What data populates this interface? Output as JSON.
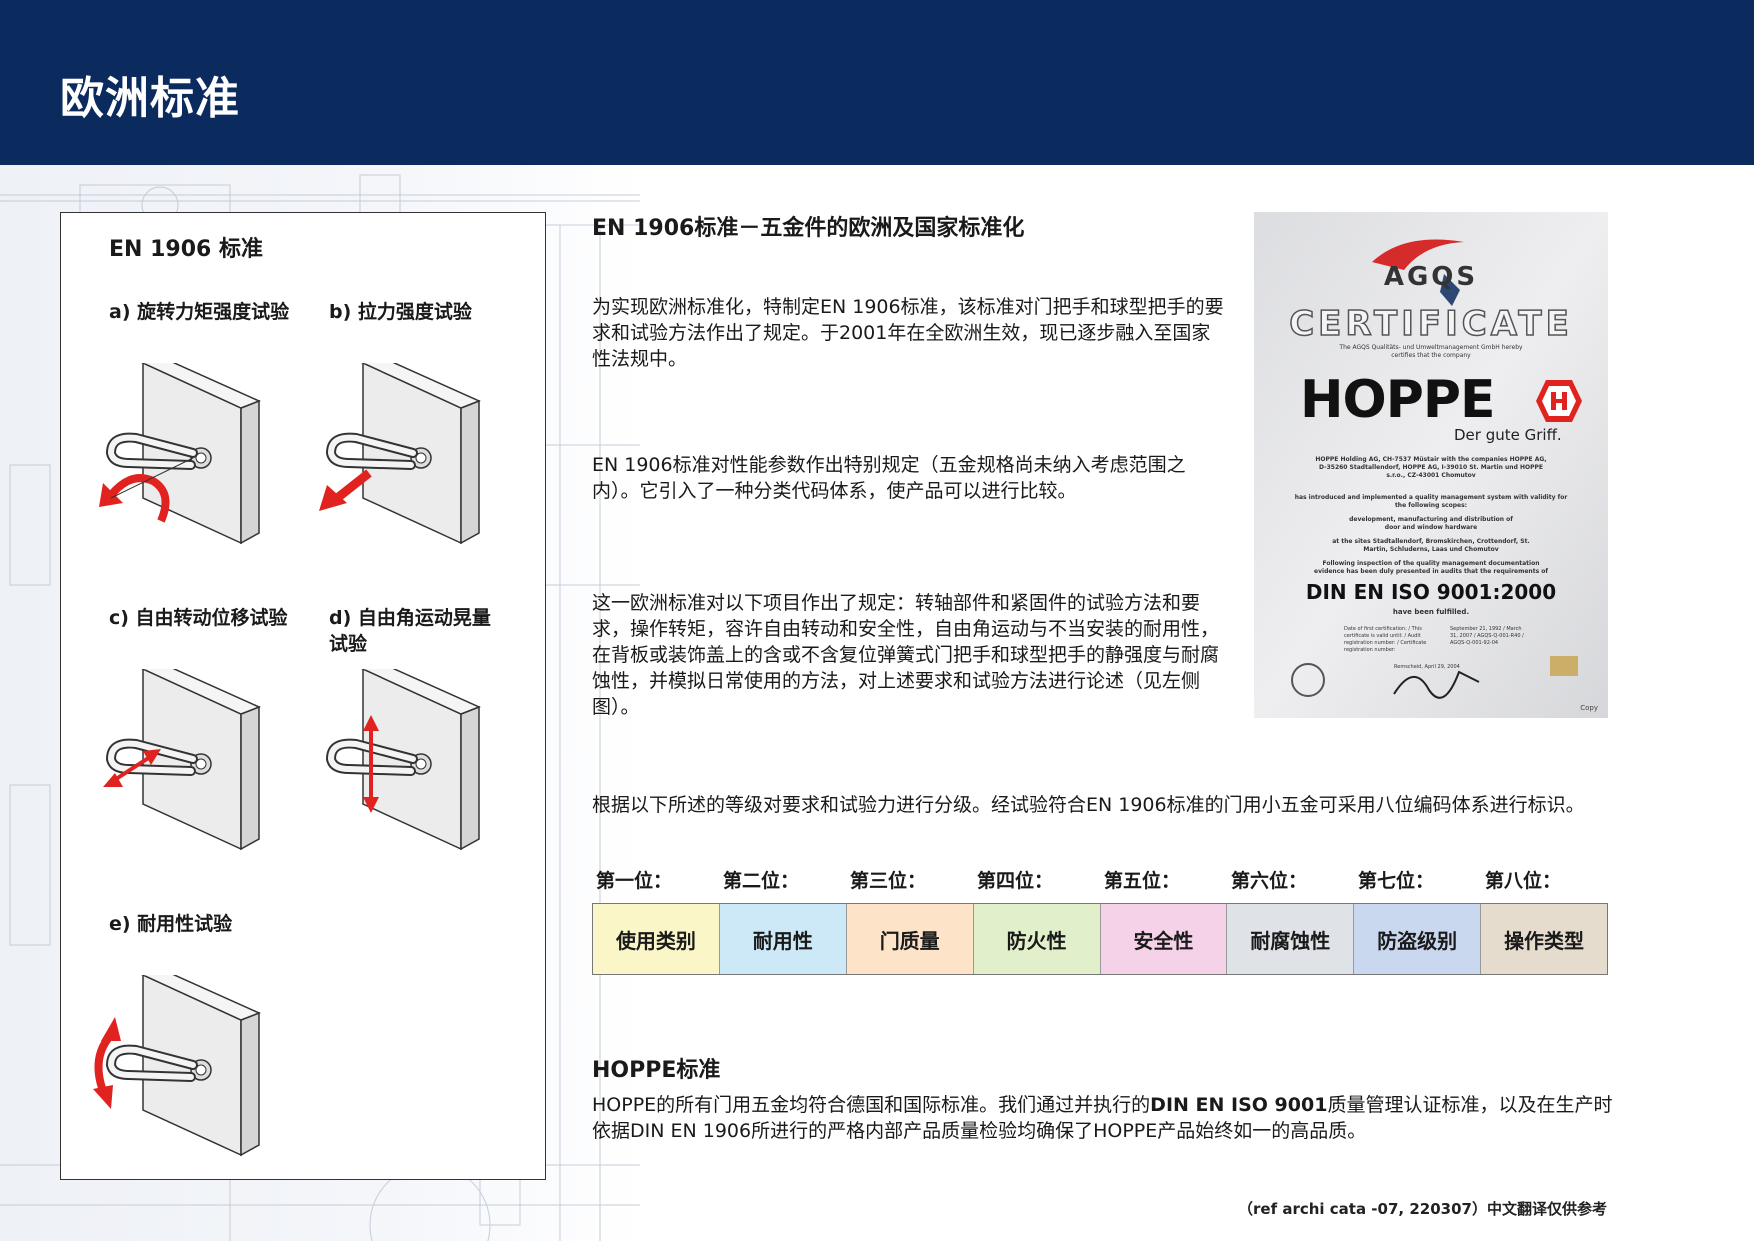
{
  "header": {
    "title": "欧洲标准"
  },
  "panel": {
    "title": "EN 1906 标准",
    "tests": [
      {
        "label": "a) 旋转力矩强度试验"
      },
      {
        "label": "b) 拉力强度试验"
      },
      {
        "label": "c) 自由转动位移试验"
      },
      {
        "label": "d) 自由角运动晃量试验"
      },
      {
        "label": "e) 耐用性试验"
      }
    ]
  },
  "main": {
    "section1_title": "EN 1906标准－五金件的欧洲及国家标准化",
    "para1": "为实现欧洲标准化，特制定EN 1906标准，该标准对门把手和球型把手的要求和试验方法作出了规定。于2001年在全欧洲生效，现已逐步融入至国家性法规中。",
    "para2": "EN 1906标准对性能参数作出特别规定（五金规格尚未纳入考虑范围之内）。它引入了一种分类代码体系，使产品可以进行比较。",
    "para3": "这一欧洲标准对以下项目作出了规定：转轴部件和紧固件的试验方法和要求，操作转矩，容许自由转动和安全性，自由角运动与不当安装的耐用性，在背板或装饰盖上的含或不含复位弹簧式门把手和球型把手的静强度与耐腐蚀性，并模拟日常使用的方法，对上述要求和试验方法进行论述（见左侧图）。",
    "para4": "根据以下所述的等级对要求和试验力进行分级。经试验符合EN 1906标准的门用小五金可采用八位编码体系进行标识。"
  },
  "classification": {
    "positions": [
      {
        "label": "第一位：",
        "value": "使用类别",
        "color": "#fbf6c8"
      },
      {
        "label": "第二位：",
        "value": "耐用性",
        "color": "#cde9f8"
      },
      {
        "label": "第三位：",
        "value": "门质量",
        "color": "#fde3c8"
      },
      {
        "label": "第四位：",
        "value": "防火性",
        "color": "#e1efcb"
      },
      {
        "label": "第五位：",
        "value": "安全性",
        "color": "#f6d2e8"
      },
      {
        "label": "第六位：",
        "value": "耐腐蚀性",
        "color": "#dfe3e8"
      },
      {
        "label": "第七位：",
        "value": "防盗级别",
        "color": "#c9d7ef"
      },
      {
        "label": "第八位：",
        "value": "操作类型",
        "color": "#e6dccd"
      }
    ]
  },
  "hoppe": {
    "title": "HOPPE标准",
    "text_before": "HOPPE的所有门用五金均符合德国和国际标准。我们通过并执行的",
    "text_bold": "DIN EN ISO 9001",
    "text_after": "质量管理认证标准，以及在生产时依据DIN EN 1906所进行的严格内部产品质量检验均确保了HOPPE产品始终如一的高品质。"
  },
  "certificate": {
    "issuer": "AGQS",
    "heading": "CERTIFICATE",
    "intro": "The AGQS Qualitäts- und Umweltmanagement GmbH hereby certifies that the company",
    "brand": "HOPPE",
    "slogan": "Der gute Griff.",
    "companies": "HOPPE Holding AG, CH-7537 Müstair with the companies HOPPE AG, D-35260 Stadtallendorf, HOPPE AG, I-39010 St. Martin und HOPPE s.r.o., CZ-43001 Chomutov",
    "scope_intro": "has introduced and implemented a quality management system with validity for the following scopes:",
    "scope": "development, manufacturing and distribution of door and window hardware",
    "sites": "at the sites Stadtallendorf, Bromskirchen, Crottendorf, St. Martin, Schluderns, Laas und Chomutov",
    "inspection": "Following inspection of the quality management documentation evidence has been duly presented in audits that the requirements of",
    "standard": "DIN EN ISO 9001:2000",
    "fulfilled": "have been fulfilled.",
    "date_lines": "Date of first certification: / This certificate is valid until: / Audit registration number: / Certificate registration number:",
    "date_values": "September 21, 1992 / March 31, 2007 / AGQS-Q-001-R40 / AGQS-Q-001-92-04",
    "place": "Remscheid, April 29, 2004",
    "copy": "Copy"
  },
  "footnote": "（ref archi cata -07, 220307）中文翻译仅供参考",
  "colors": {
    "header": "#0b2a5e",
    "arrow": "#e0231f"
  }
}
